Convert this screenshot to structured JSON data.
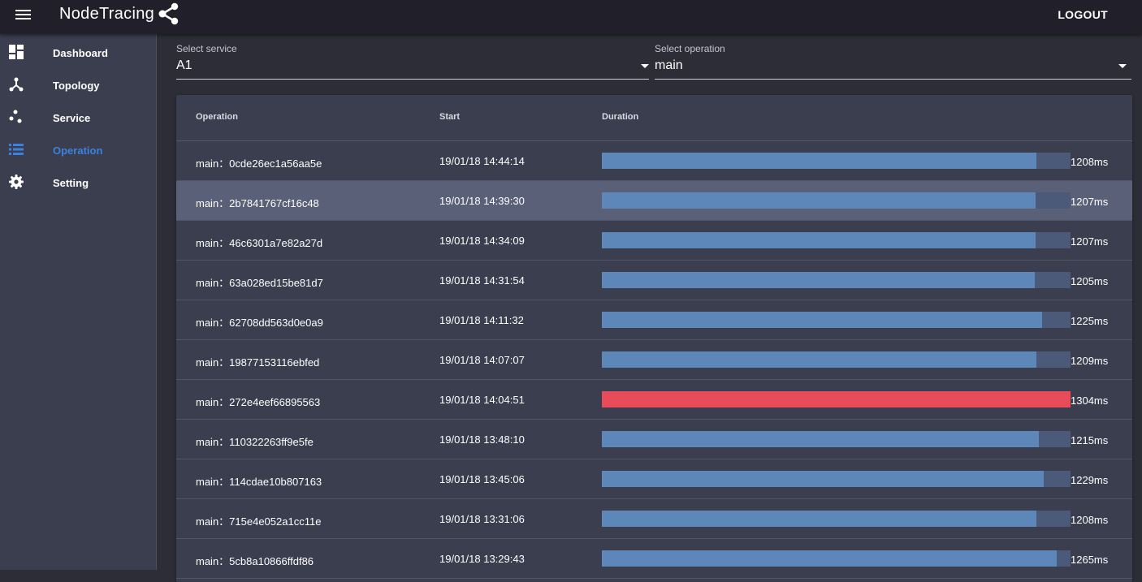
{
  "appbar": {
    "title": "NodeTracing",
    "logout_label": "LOGOUT"
  },
  "sidebar": {
    "items": [
      {
        "label": "Dashboard",
        "icon": "dashboard-icon",
        "active": false
      },
      {
        "label": "Topology",
        "icon": "topology-icon",
        "active": false
      },
      {
        "label": "Service",
        "icon": "service-icon",
        "active": false
      },
      {
        "label": "Operation",
        "icon": "list-icon",
        "active": true
      },
      {
        "label": "Setting",
        "icon": "gear-icon",
        "active": false
      }
    ]
  },
  "filters": {
    "service": {
      "label": "Select service",
      "value": "A1"
    },
    "operation": {
      "label": "Select operation",
      "value": "main"
    }
  },
  "table": {
    "columns": [
      "Operation",
      "Start",
      "Duration"
    ],
    "max_duration_ms": 1304,
    "rows": [
      {
        "operation": "main：0cde26ec1a56aa5e",
        "start": "19/01/18 14:44:14",
        "duration_ms": 1208,
        "duration": "1208ms",
        "selected": false,
        "slow": false
      },
      {
        "operation": "main：2b7841767cf16c48",
        "start": "19/01/18 14:39:30",
        "duration_ms": 1207,
        "duration": "1207ms",
        "selected": true,
        "slow": false
      },
      {
        "operation": "main：46c6301a7e82a27d",
        "start": "19/01/18 14:34:09",
        "duration_ms": 1207,
        "duration": "1207ms",
        "selected": false,
        "slow": false
      },
      {
        "operation": "main：63a028ed15be81d7",
        "start": "19/01/18 14:31:54",
        "duration_ms": 1205,
        "duration": "1205ms",
        "selected": false,
        "slow": false
      },
      {
        "operation": "main：62708dd563d0e0a9",
        "start": "19/01/18 14:11:32",
        "duration_ms": 1225,
        "duration": "1225ms",
        "selected": false,
        "slow": false
      },
      {
        "operation": "main：19877153116ebfed",
        "start": "19/01/18 14:07:07",
        "duration_ms": 1209,
        "duration": "1209ms",
        "selected": false,
        "slow": false
      },
      {
        "operation": "main：272e4eef66895563",
        "start": "19/01/18 14:04:51",
        "duration_ms": 1304,
        "duration": "1304ms",
        "selected": false,
        "slow": true
      },
      {
        "operation": "main：110322263ff9e5fe",
        "start": "19/01/18 13:48:10",
        "duration_ms": 1215,
        "duration": "1215ms",
        "selected": false,
        "slow": false
      },
      {
        "operation": "main：114cdae10b807163",
        "start": "19/01/18 13:45:06",
        "duration_ms": 1229,
        "duration": "1229ms",
        "selected": false,
        "slow": false
      },
      {
        "operation": "main：715e4e052a1cc11e",
        "start": "19/01/18 13:31:06",
        "duration_ms": 1208,
        "duration": "1208ms",
        "selected": false,
        "slow": false
      },
      {
        "operation": "main：5cb8a10866ffdf86",
        "start": "19/01/18 13:29:43",
        "duration_ms": 1265,
        "duration": "1265ms",
        "selected": false,
        "slow": false
      }
    ]
  },
  "colors": {
    "accent": "#3b82e0",
    "bar": "#5c87b8",
    "bar_track": "#4a5a78",
    "bar_slow": "#e84b5a"
  }
}
